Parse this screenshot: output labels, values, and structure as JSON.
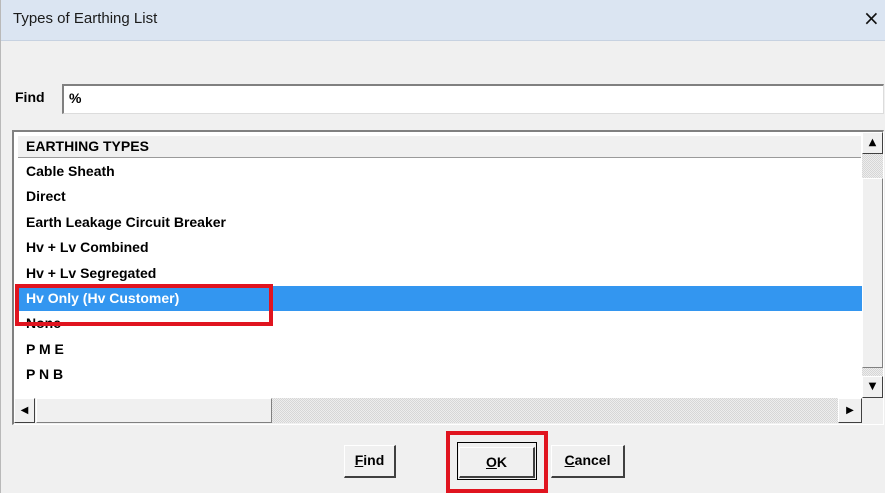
{
  "window": {
    "title": "Types of Earthing List",
    "close_label": "×"
  },
  "find": {
    "label": "Find",
    "value": "%"
  },
  "list": {
    "column_header": "EARTHING TYPES",
    "rows": [
      "Cable Sheath",
      "Direct",
      "Earth Leakage Circuit Breaker",
      "Hv + Lv Combined",
      "Hv + Lv Segregated",
      "Hv Only  (Hv Customer)",
      "None",
      "P M E",
      "P N B"
    ],
    "selected_index": 5
  },
  "scroll": {
    "up": "▲",
    "down": "▼",
    "left": "◀",
    "right": "▶"
  },
  "buttons": {
    "find": {
      "underline": "F",
      "rest": "ind"
    },
    "ok": {
      "underline": "O",
      "rest": "K"
    },
    "cancel": {
      "underline": "C",
      "rest": "ancel"
    }
  },
  "colors": {
    "selection": "#3396f0",
    "highlight": "#e0141f"
  }
}
